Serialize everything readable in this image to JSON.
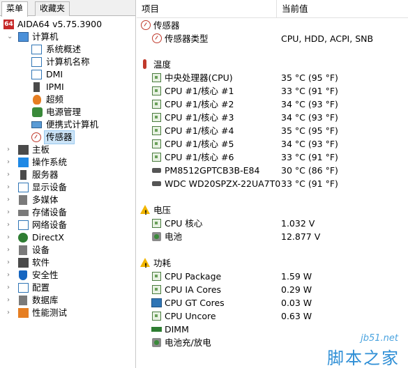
{
  "tabs": {
    "menu": "菜单",
    "favorites": "收藏夹"
  },
  "tree": {
    "root": {
      "label": "AIDA64 v5.75.3900",
      "logo": "64"
    },
    "computer": {
      "label": "计算机",
      "children": [
        "系统概述",
        "计算机名称",
        "DMI",
        "IPMI",
        "超频",
        "电源管理",
        "便携式计算机",
        "传感器"
      ]
    },
    "categories": [
      "主板",
      "操作系统",
      "服务器",
      "显示设备",
      "多媒体",
      "存储设备",
      "网络设备",
      "DirectX",
      "设备",
      "软件",
      "安全性",
      "配置",
      "数据库",
      "性能测试"
    ]
  },
  "header": {
    "item": "项目",
    "value": "当前值"
  },
  "sections": [
    {
      "title": "传感器",
      "icon": "gauge-icon",
      "rows": [
        {
          "item": "传感器类型",
          "value": "CPU, HDD, ACPI, SNB",
          "icon": "gauge-icon"
        }
      ]
    },
    {
      "title": "温度",
      "icon": "thermometer-icon",
      "rows": [
        {
          "item": "中央处理器(CPU)",
          "value": "35 °C  (95 °F)",
          "icon": "cpu-icon"
        },
        {
          "item": "CPU #1/核心 #1",
          "value": "33 °C  (91 °F)",
          "icon": "cpu-icon"
        },
        {
          "item": "CPU #1/核心 #2",
          "value": "34 °C  (93 °F)",
          "icon": "cpu-icon"
        },
        {
          "item": "CPU #1/核心 #3",
          "value": "34 °C  (93 °F)",
          "icon": "cpu-icon"
        },
        {
          "item": "CPU #1/核心 #4",
          "value": "35 °C  (95 °F)",
          "icon": "cpu-icon"
        },
        {
          "item": "CPU #1/核心 #5",
          "value": "34 °C  (93 °F)",
          "icon": "cpu-icon"
        },
        {
          "item": "CPU #1/核心 #6",
          "value": "33 °C  (91 °F)",
          "icon": "cpu-icon"
        },
        {
          "item": "PM8512GPTCB3B-E84",
          "value": "30 °C  (86 °F)",
          "icon": "disk-icon"
        },
        {
          "item": "WDC WD20SPZX-22UA7T0",
          "value": "33 °C  (91 °F)",
          "icon": "disk-icon"
        }
      ]
    },
    {
      "title": "电压",
      "icon": "warning-icon",
      "rows": [
        {
          "item": "CPU 核心",
          "value": "1.032 V",
          "icon": "cpu-icon"
        },
        {
          "item": "电池",
          "value": "12.877 V",
          "icon": "battery-icon"
        }
      ]
    },
    {
      "title": "功耗",
      "icon": "warning-icon",
      "rows": [
        {
          "item": "CPU Package",
          "value": "1.59 W",
          "icon": "cpu-icon"
        },
        {
          "item": "CPU IA Cores",
          "value": "0.29 W",
          "icon": "cpu-icon"
        },
        {
          "item": "CPU GT Cores",
          "value": "0.03 W",
          "icon": "gpu-icon"
        },
        {
          "item": "CPU Uncore",
          "value": "0.63 W",
          "icon": "cpu-icon"
        },
        {
          "item": "DIMM",
          "value": "",
          "icon": "memory-icon"
        },
        {
          "item": "电池充/放电",
          "value": "",
          "icon": "battery-icon"
        }
      ]
    }
  ],
  "watermark": {
    "url": "jb51.net",
    "text": "脚本之家"
  },
  "colors": {
    "selection": "#cce4f7",
    "warning": "#f2b600",
    "sensor_green": "#4a7c3f",
    "watermark_blue": "#2f8fd6"
  }
}
